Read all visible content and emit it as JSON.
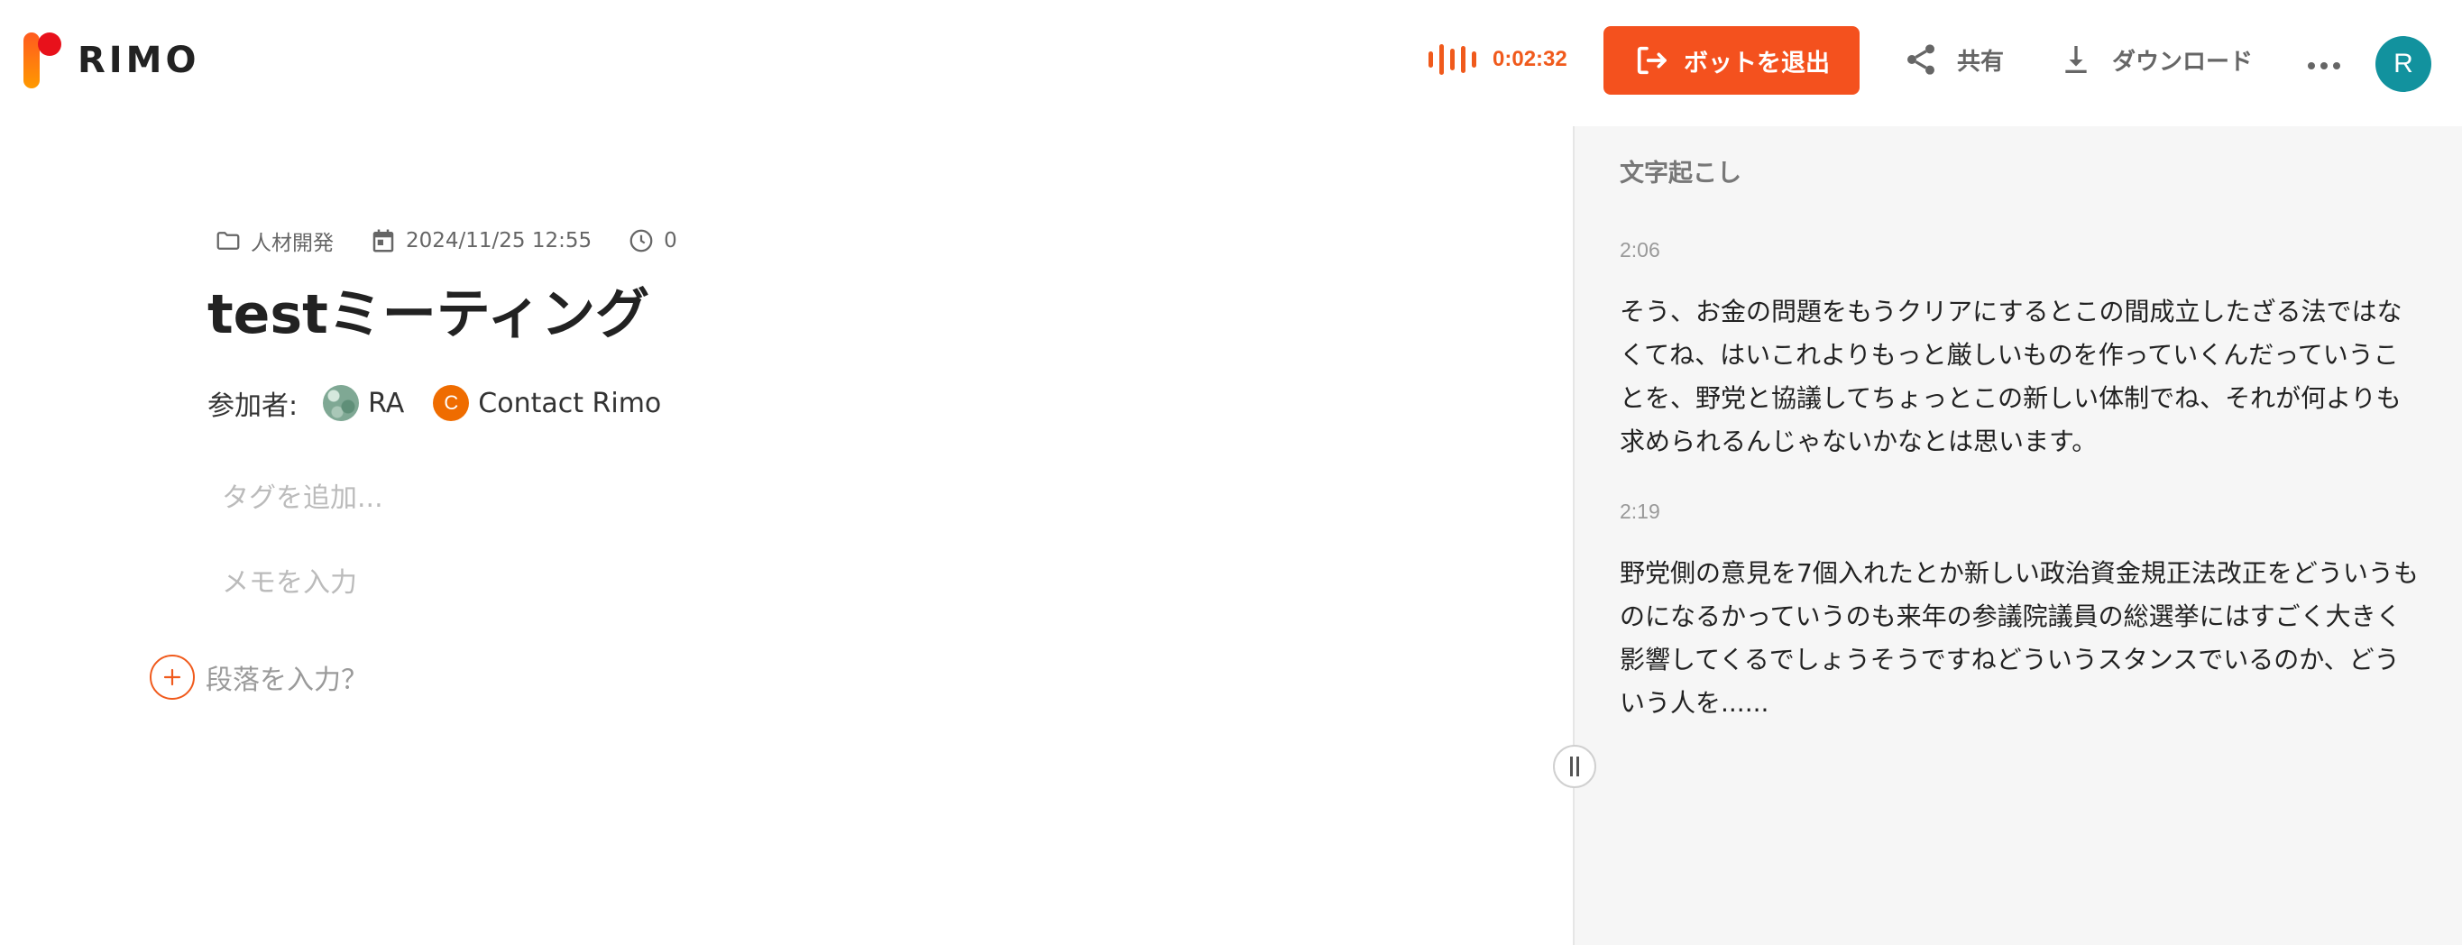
{
  "header": {
    "logo_text": "RIMO",
    "recording_time": "0:02:32",
    "exit_bot_label": "ボットを退出",
    "share_label": "共有",
    "download_label": "ダウンロード",
    "user_initial": "R"
  },
  "meeting": {
    "folder": "人材開発",
    "date": "2024/11/25 12:55",
    "duration": "0",
    "title": "testミーティング",
    "participants_label": "参加者:",
    "participants": [
      {
        "name": "RA",
        "avatar": "image"
      },
      {
        "name": "Contact Rimo",
        "initial": "C"
      }
    ],
    "tag_placeholder": "タグを追加...",
    "memo_placeholder": "メモを入力",
    "paragraph_label": "段落を入力？"
  },
  "transcript": {
    "title": "文字起こし",
    "segments": [
      {
        "time": "2:06",
        "lines": [
          "そう、お金の問題をもうクリアにするとこの間成立したざる法ではな",
          "くてね、はいこれよりもっと厳しいものを作っていくんだっていうこ",
          "とを、野党と協議してちょっとこの新しい体制でね、それが何よりも",
          "求められるんじゃないかなとは思います。"
        ]
      },
      {
        "time": "2:19",
        "lines": [
          "野党側の意見を7個入れたとか新しい政治資金規正法改正をどういうも",
          "のになるかっていうのも来年の参議院議員の総選挙にはすごく大きく",
          "影響してくるでしょうそうですねどういうスタンスでいるのか、どう",
          "いう人を......"
        ]
      }
    ]
  },
  "colors": {
    "accent": "#f4511e",
    "avatar": "#12929e"
  }
}
